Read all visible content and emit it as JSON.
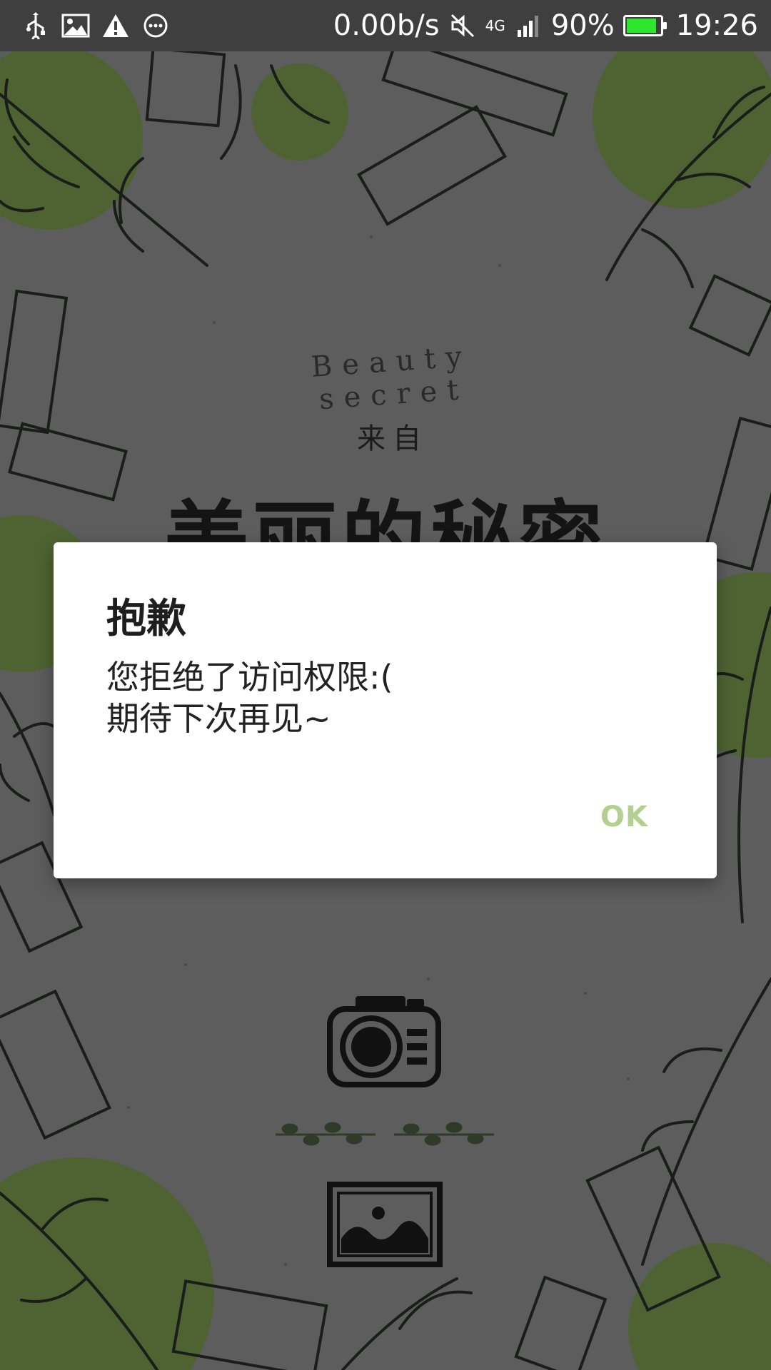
{
  "status_bar": {
    "left_icons": [
      "usb-icon",
      "image-icon",
      "warning-icon",
      "more-icon"
    ],
    "network_speed": "0.00b/s",
    "network_type": "4G",
    "battery_percent": "90%",
    "battery_level": 0.9,
    "time": "19:26",
    "colors": {
      "bar": "#3f3f3f",
      "battery": "#2ee62e"
    }
  },
  "background": {
    "subtitle": "Beauty secret",
    "from_label": "来自",
    "app_title": "美丽的秘密",
    "colors": {
      "backdrop": "#5d5d5d",
      "accent_green": "#4e6331"
    }
  },
  "actions": {
    "camera": {
      "icon": "camera-icon"
    },
    "gallery": {
      "icon": "gallery-icon"
    }
  },
  "dialog": {
    "title": "抱歉",
    "message_line1": "您拒绝了访问权限:(",
    "message_line2": "期待下次再见~",
    "ok_label": "OK",
    "colors": {
      "ok": "#b3d08f"
    }
  }
}
